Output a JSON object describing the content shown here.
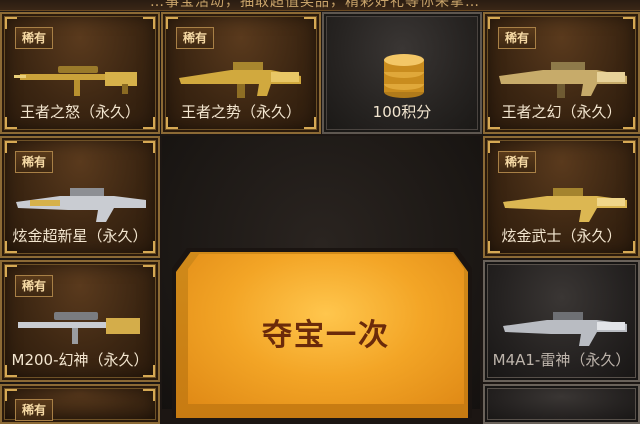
{
  "header": {
    "text": "…事宝活动，抽取超值奖品，精彩好礼等你来拿…"
  },
  "rarity_label": "稀有",
  "slots": [
    {
      "id": "s1",
      "name": "王者之怒（永久）",
      "rare": true,
      "icon": "sniper-rifle-gold-icon"
    },
    {
      "id": "s2",
      "name": "王者之势（永久）",
      "rare": true,
      "icon": "assault-rifle-gold-icon"
    },
    {
      "id": "s3",
      "name": "100积分",
      "rare": false,
      "icon": "coin-stack-icon"
    },
    {
      "id": "s4",
      "name": "王者之幻（永久）",
      "rare": true,
      "icon": "assault-rifle-gold-icon"
    },
    {
      "id": "s5",
      "name": "炫金超新星（永久）",
      "rare": true,
      "icon": "assault-rifle-silver-icon"
    },
    {
      "id": "s6",
      "name": "炫金武士（永久）",
      "rare": true,
      "icon": "assault-rifle-gold-icon"
    },
    {
      "id": "s7",
      "name": "M200-幻神（永久）",
      "rare": true,
      "icon": "sniper-rifle-gold-icon"
    },
    {
      "id": "s8",
      "name": "M4A1-雷神（永久）",
      "rare": false,
      "icon": "assault-rifle-silver-icon"
    },
    {
      "id": "s9",
      "name": "",
      "rare": true,
      "icon": "rifle-icon"
    }
  ],
  "action": {
    "draw_label": "夺宝一次"
  }
}
